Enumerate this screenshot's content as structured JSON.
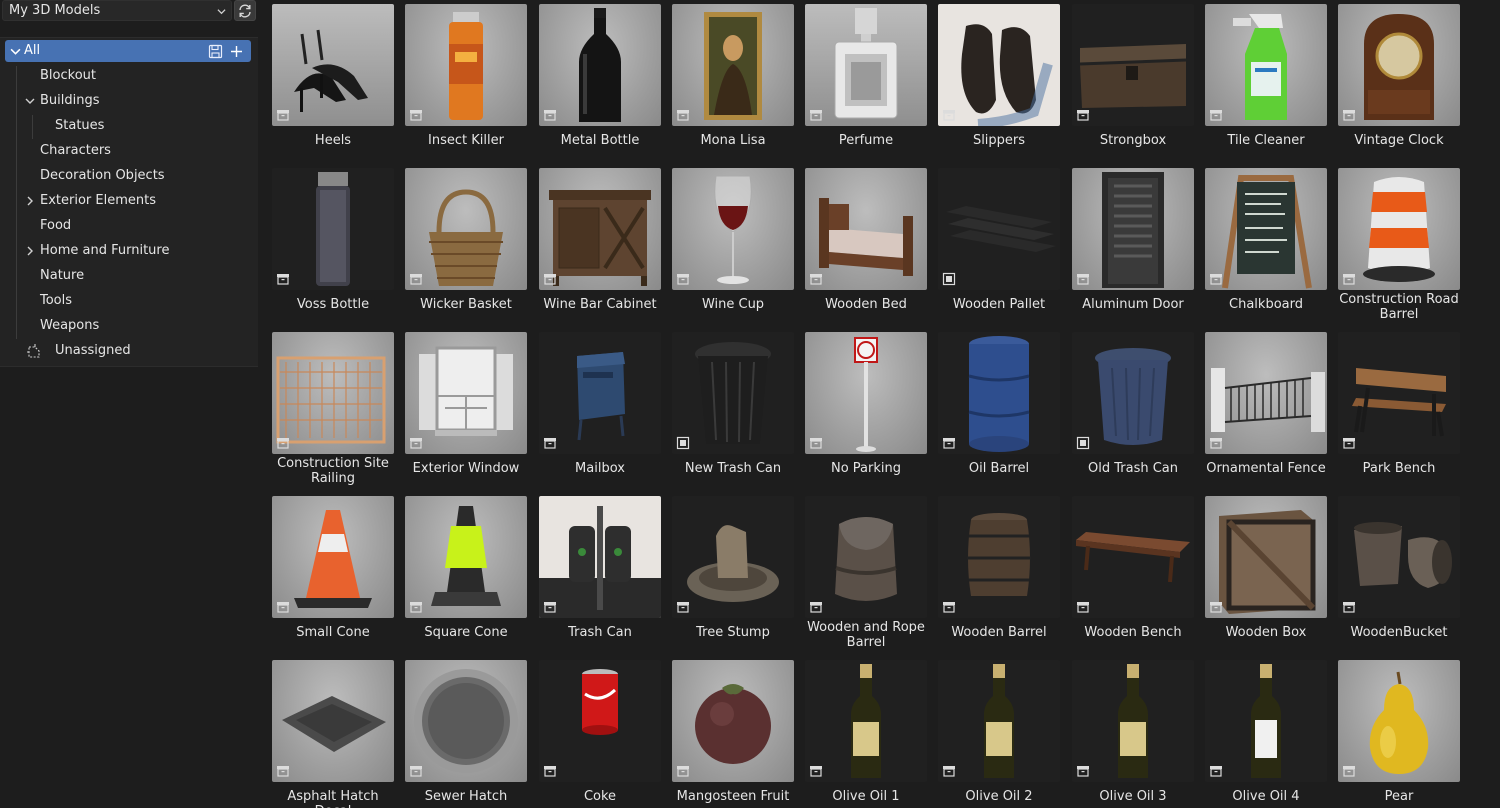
{
  "library": {
    "selected": "My 3D Models"
  },
  "catalog_tree": {
    "all_label": "All",
    "items": [
      {
        "label": "Blockout",
        "depth": 1,
        "expandable": false
      },
      {
        "label": "Buildings",
        "depth": 1,
        "expandable": true,
        "expanded": true
      },
      {
        "label": "Statues",
        "depth": 2,
        "expandable": false
      },
      {
        "label": "Characters",
        "depth": 1,
        "expandable": false
      },
      {
        "label": "Decoration Objects",
        "depth": 1,
        "expandable": false
      },
      {
        "label": "Exterior Elements",
        "depth": 1,
        "expandable": true,
        "expanded": false
      },
      {
        "label": "Food",
        "depth": 1,
        "expandable": false
      },
      {
        "label": "Home and Furniture",
        "depth": 1,
        "expandable": true,
        "expanded": false
      },
      {
        "label": "Nature",
        "depth": 1,
        "expandable": false
      },
      {
        "label": "Tools",
        "depth": 1,
        "expandable": false
      },
      {
        "label": "Weapons",
        "depth": 1,
        "expandable": false
      }
    ],
    "unassigned_label": "Unassigned"
  },
  "colors": {
    "selection": "#4772b3",
    "panel": "#232323",
    "background": "#1d1d1d"
  },
  "assets": [
    {
      "label": "Heels",
      "thumb": "heels",
      "bg": "studio",
      "badge": "object"
    },
    {
      "label": "Insect Killer",
      "thumb": "spray-can",
      "bg": "light",
      "badge": "object"
    },
    {
      "label": "Metal Bottle",
      "thumb": "black-bottle",
      "bg": "light",
      "badge": "object"
    },
    {
      "label": "Mona Lisa",
      "thumb": "painting",
      "bg": "light",
      "badge": "object"
    },
    {
      "label": "Perfume",
      "thumb": "perfume",
      "bg": "studio",
      "badge": "object"
    },
    {
      "label": "Slippers",
      "thumb": "slippers",
      "bg": "white",
      "badge": "object"
    },
    {
      "label": "Strongbox",
      "thumb": "chest",
      "bg": "dark",
      "badge": "object"
    },
    {
      "label": "Tile Cleaner",
      "thumb": "spray-bottle",
      "bg": "light",
      "badge": "object"
    },
    {
      "label": "Vintage Clock",
      "thumb": "clock",
      "bg": "light",
      "badge": "object"
    },
    {
      "label": "Voss Bottle",
      "thumb": "voss",
      "bg": "dark",
      "badge": "object"
    },
    {
      "label": "Wicker Basket",
      "thumb": "basket",
      "bg": "light",
      "badge": "object"
    },
    {
      "label": "Wine Bar Cabinet",
      "thumb": "cabinet",
      "bg": "light",
      "badge": "object"
    },
    {
      "label": "Wine Cup",
      "thumb": "wine-glass",
      "bg": "light",
      "badge": "object"
    },
    {
      "label": "Wooden Bed",
      "thumb": "bed",
      "bg": "light",
      "badge": "object"
    },
    {
      "label": "Wooden Pallet",
      "thumb": "pallet",
      "bg": "dark",
      "badge": "collection"
    },
    {
      "label": "Aluminum Door",
      "thumb": "door",
      "bg": "light",
      "badge": "object"
    },
    {
      "label": "Chalkboard",
      "thumb": "chalkboard",
      "bg": "light",
      "badge": "object"
    },
    {
      "label": "Construction Road Barrel",
      "thumb": "road-barrel",
      "bg": "light",
      "badge": "object"
    },
    {
      "label": "Construction Site Railing",
      "thumb": "railing",
      "bg": "light",
      "badge": "object"
    },
    {
      "label": "Exterior Window",
      "thumb": "window",
      "bg": "light",
      "badge": "object"
    },
    {
      "label": "Mailbox",
      "thumb": "mailbox",
      "bg": "dark",
      "badge": "object"
    },
    {
      "label": "New Trash Can",
      "thumb": "trash-can-dark",
      "bg": "dark",
      "badge": "collection"
    },
    {
      "label": "No Parking",
      "thumb": "sign",
      "bg": "light",
      "badge": "object"
    },
    {
      "label": "Oil Barrel",
      "thumb": "oil-barrel",
      "bg": "dark",
      "badge": "object"
    },
    {
      "label": "Old Trash Can",
      "thumb": "trash-can-blue",
      "bg": "dark",
      "badge": "collection"
    },
    {
      "label": "Ornamental Fence",
      "thumb": "fence",
      "bg": "light",
      "badge": "object"
    },
    {
      "label": "Park Bench",
      "thumb": "park-bench",
      "bg": "dark",
      "badge": "object"
    },
    {
      "label": "Small Cone",
      "thumb": "cone",
      "bg": "light",
      "badge": "object"
    },
    {
      "label": "Square Cone",
      "thumb": "square-cone",
      "bg": "light",
      "badge": "object"
    },
    {
      "label": "Trash Can",
      "thumb": "bin",
      "bg": "white",
      "badge": "object"
    },
    {
      "label": "Tree Stump",
      "thumb": "stump",
      "bg": "dark",
      "badge": "object"
    },
    {
      "label": "Wooden and Rope Barrel",
      "thumb": "rope-barrel",
      "bg": "dark",
      "badge": "object"
    },
    {
      "label": "Wooden Barrel",
      "thumb": "barrel",
      "bg": "dark",
      "badge": "object"
    },
    {
      "label": "Wooden Bench",
      "thumb": "bench",
      "bg": "dark",
      "badge": "object"
    },
    {
      "label": "Wooden Box",
      "thumb": "crate",
      "bg": "light",
      "badge": "object"
    },
    {
      "label": "WoodenBucket",
      "thumb": "bucket",
      "bg": "dark",
      "badge": "object"
    },
    {
      "label": "Asphalt Hatch Decal",
      "thumb": "hatch-decal",
      "bg": "light",
      "badge": "object"
    },
    {
      "label": "Sewer Hatch",
      "thumb": "manhole",
      "bg": "light",
      "badge": "object"
    },
    {
      "label": "Coke",
      "thumb": "coke-can",
      "bg": "dark",
      "badge": "object"
    },
    {
      "label": "Mangosteen Fruit",
      "thumb": "mangosteen",
      "bg": "light",
      "badge": "object"
    },
    {
      "label": "Olive Oil 1",
      "thumb": "olive-oil",
      "bg": "dark",
      "badge": "object"
    },
    {
      "label": "Olive Oil 2",
      "thumb": "olive-oil",
      "bg": "dark",
      "badge": "object"
    },
    {
      "label": "Olive Oil 3",
      "thumb": "olive-oil",
      "bg": "dark",
      "badge": "object"
    },
    {
      "label": "Olive Oil 4",
      "thumb": "olive-oil-white",
      "bg": "dark",
      "badge": "object"
    },
    {
      "label": "Pear",
      "thumb": "pear",
      "bg": "light",
      "badge": "object"
    }
  ]
}
